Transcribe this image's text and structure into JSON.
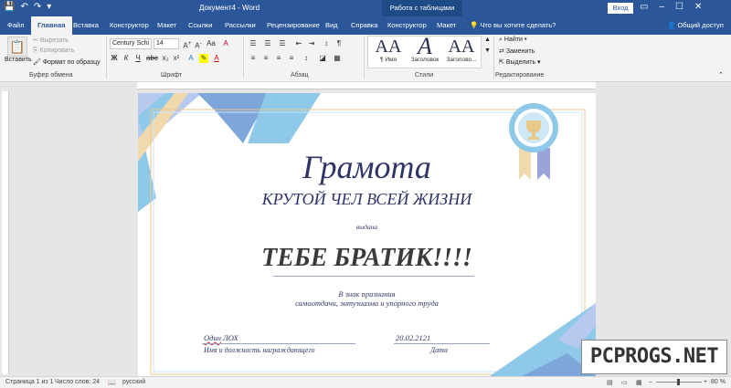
{
  "titlebar": {
    "quick_access": {
      "save": "💾",
      "undo": "↶",
      "redo": "↷",
      "more": "▾"
    },
    "doc_title": "Документ4 - Word",
    "context_title": "Работа с таблицами",
    "signin_label": "Вход",
    "window_buttons": {
      "restore": "▭",
      "minimize": "–",
      "maximize": "☐",
      "close": "✕"
    }
  },
  "tabs": [
    {
      "label": "Файл"
    },
    {
      "label": "Главная"
    },
    {
      "label": "Вставка"
    },
    {
      "label": "Конструктор"
    },
    {
      "label": "Макет"
    },
    {
      "label": "Ссылки"
    },
    {
      "label": "Рассылки"
    },
    {
      "label": "Рецензирование"
    },
    {
      "label": "Вид"
    },
    {
      "label": "Справка"
    },
    {
      "label": "Конструктор"
    },
    {
      "label": "Макет"
    }
  ],
  "tell_me": "Что вы хотите сделать?",
  "share": "Общий доступ",
  "ribbon": {
    "clipboard": {
      "paste": "Вставить",
      "cut": "Вырезать",
      "copy": "Копировать",
      "format_painter": "Формат по образцу",
      "group_label": "Буфер обмена"
    },
    "font": {
      "font_name": "Century Schi",
      "font_size": "14",
      "group_label": "Шрифт",
      "bold": "Ж",
      "italic": "К",
      "underline": "Ч"
    },
    "paragraph": {
      "group_label": "Абзац"
    },
    "styles": {
      "items": [
        {
          "preview": "АА",
          "label": "¶ Имя"
        },
        {
          "preview": "А",
          "label": "Заголовок"
        },
        {
          "preview": "АА",
          "label": "Заголово..."
        }
      ],
      "group_label": "Стили"
    },
    "editing": {
      "find": "Найти",
      "replace": "Заменить",
      "select": "Выделить",
      "group_label": "Редактирование"
    }
  },
  "certificate": {
    "title": "Грамота",
    "subtitle": "КРУТОЙ ЧЕЛ ВСЕЙ ЖИЗНИ",
    "issued": "выдана",
    "recipient": "ТЕБЕ БРАТИК!!!!",
    "recognition_line1": "В знак признания",
    "recognition_line2": "самоотдачи, энтузиазма и упорного труда",
    "signer_first": "Один",
    "signer_second": "ЛОХ",
    "signer_caption": "Имя и должность награждающего",
    "date": "20.02.2121",
    "date_caption": "Дата"
  },
  "watermark": "PCPROGS.NET",
  "status": {
    "page": "Страница 1 из 1",
    "words": "Число слов: 24",
    "language": "русский",
    "zoom": "80 %"
  },
  "colors": {
    "word_blue": "#2b579a",
    "cert_navy": "#2e3566",
    "light_blue": "#8fc9ea",
    "gold": "#e8c98a"
  }
}
